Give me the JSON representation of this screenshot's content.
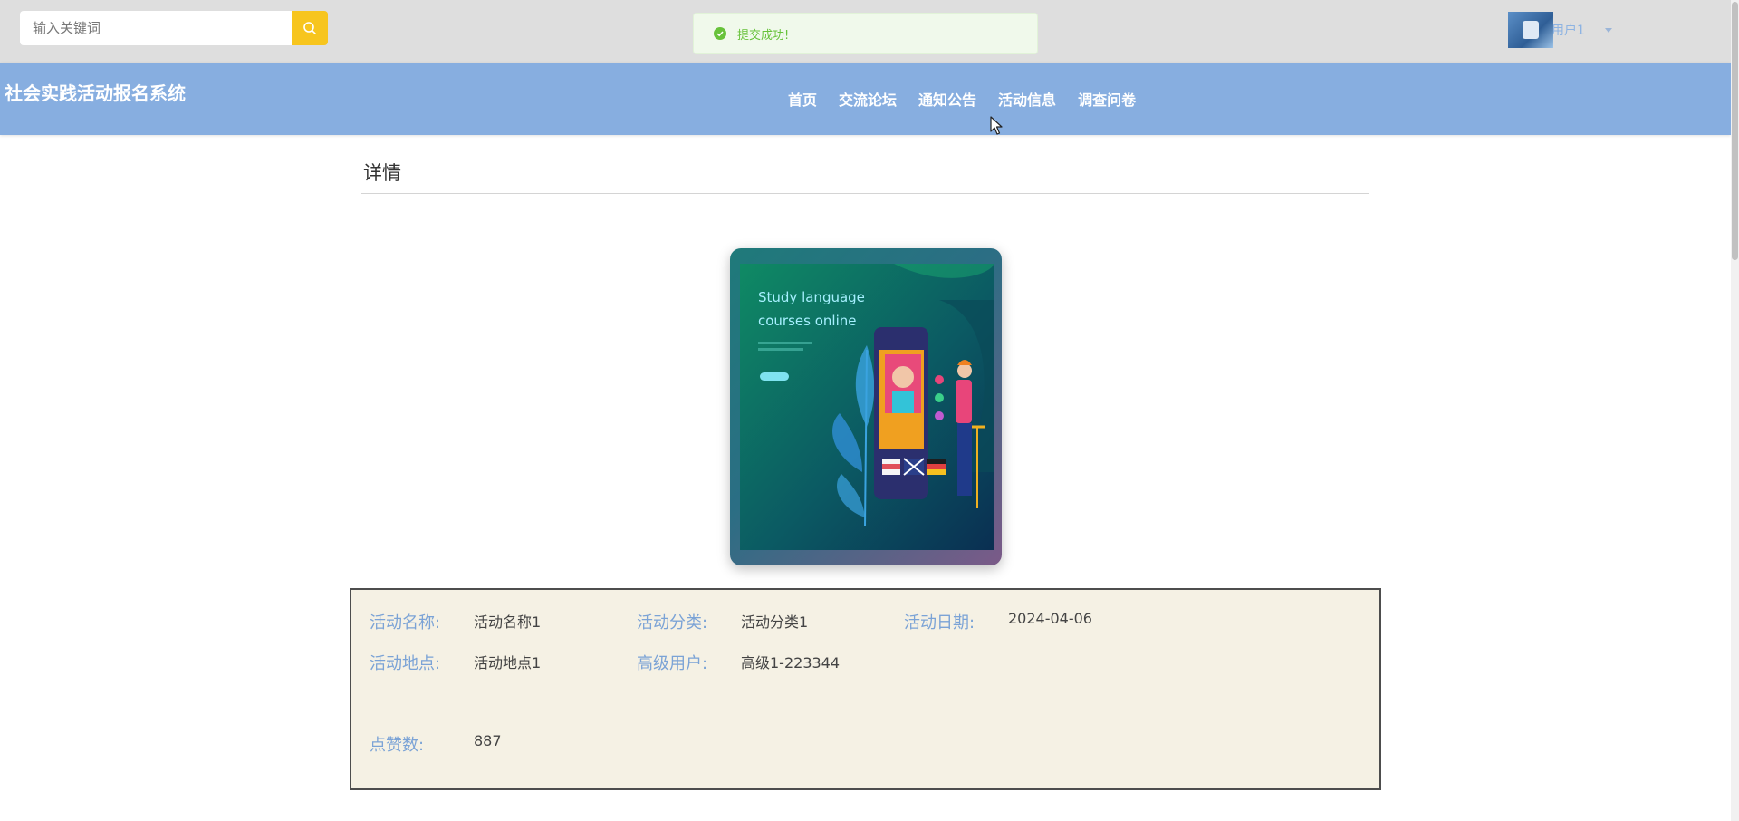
{
  "search": {
    "placeholder": "输入关键词"
  },
  "toast": {
    "message": "提交成功!"
  },
  "user": {
    "name": "用户1"
  },
  "site": {
    "title": "社会实践活动报名系统"
  },
  "nav": {
    "items": [
      "首页",
      "交流论坛",
      "通知公告",
      "活动信息",
      "调查问卷"
    ]
  },
  "page": {
    "title": "详情"
  },
  "image": {
    "headline_line1": "Study language",
    "headline_line2": "courses online"
  },
  "details": {
    "activity_name": {
      "label": "活动名称:",
      "value": "活动名称1"
    },
    "activity_category": {
      "label": "活动分类:",
      "value": "活动分类1"
    },
    "activity_date": {
      "label": "活动日期:",
      "value": "2024-04-06"
    },
    "activity_location": {
      "label": "活动地点:",
      "value": "活动地点1"
    },
    "senior_user": {
      "label": "高级用户:",
      "value": "高级1-223344"
    },
    "likes": {
      "label": "点赞数:",
      "value": "887"
    }
  },
  "colors": {
    "nav_background": "#87aee0",
    "search_button": "#f7c51e",
    "toast_success": "#67c23a",
    "label_text": "#7ba3d6",
    "details_background": "#f5f1e4"
  }
}
